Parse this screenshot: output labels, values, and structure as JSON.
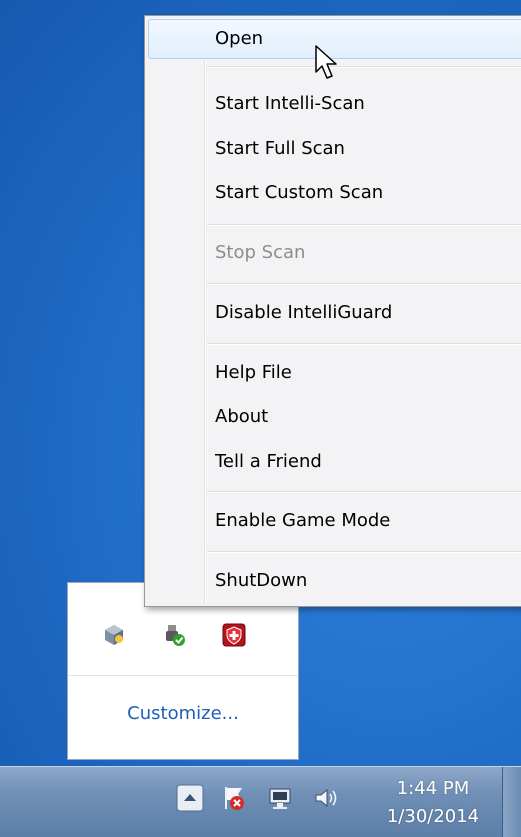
{
  "menu": {
    "items": [
      {
        "label": "Open",
        "state": "hover"
      },
      {
        "label": "Start Intelli-Scan",
        "state": "normal"
      },
      {
        "label": "Start Full Scan",
        "state": "normal"
      },
      {
        "label": "Start Custom Scan",
        "state": "normal"
      },
      {
        "label": "Stop Scan",
        "state": "disabled"
      },
      {
        "label": "Disable IntelliGuard",
        "state": "normal"
      },
      {
        "label": "Help File",
        "state": "normal"
      },
      {
        "label": "About",
        "state": "normal"
      },
      {
        "label": "Tell a Friend",
        "state": "normal"
      },
      {
        "label": "Enable Game Mode",
        "state": "normal"
      },
      {
        "label": "ShutDown",
        "state": "normal"
      }
    ]
  },
  "tray_flyout": {
    "icons": [
      "virtualbox-icon",
      "safely-remove-hardware-icon",
      "antivirus-shield-icon"
    ],
    "customize_label": "Customize..."
  },
  "taskbar": {
    "time": "1:44 PM",
    "date": "1/30/2014",
    "icons": [
      "show-hidden-icons-button",
      "action-center-flag-icon",
      "network-icon",
      "volume-icon"
    ]
  },
  "colors": {
    "desktop": "#1f6bc6",
    "menu_bg": "#f3f3f5",
    "hover_border": "#aecff7",
    "disabled_text": "#8d8d8d",
    "customize_link": "#1f5fb8"
  }
}
